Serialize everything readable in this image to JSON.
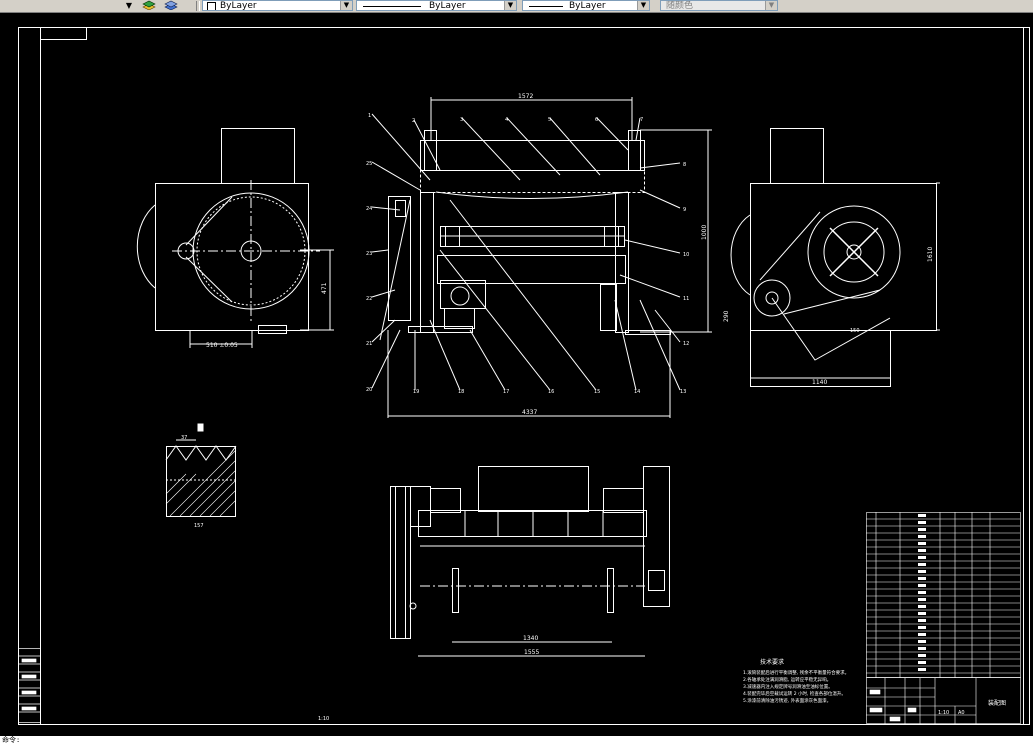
{
  "toolbar": {
    "layer_dropdown_arrow": "▼",
    "color_combo": "ByLayer",
    "linetype_combo": "ByLayer",
    "lineweight_combo": "ByLayer",
    "plotstyle_combo": "随颜色",
    "dropdown_arrow": "▼"
  },
  "drawing": {
    "front_view_width_dim": "1572",
    "front_view_total_dim": "4337",
    "front_view_height_dim": "1000",
    "side_left_dim": "510 ±0.05",
    "side_left_height_dim": "471",
    "side_right_width_dim": "1140",
    "side_right_height_dim": "1610",
    "side_right_bottom_dim": "290",
    "side_right_radius_label": "150",
    "detail_top_dim": "37",
    "detail_bottom_dim": "157",
    "plan_inner_dim": "1340",
    "plan_outer_dim": "1555",
    "scale_label": "1:10",
    "part_numbers_top": [
      "1",
      "2",
      "3",
      "4",
      "5",
      "6",
      "7",
      "8",
      "9",
      "10",
      "11",
      "12",
      "13",
      "14",
      "15",
      "16",
      "17",
      "18",
      "19",
      "20",
      "21",
      "22",
      "23",
      "24",
      "25"
    ],
    "tech_req_title": "技术要求",
    "tech_req_lines": [
      "1.滚筒装配后进行平衡调整, 残余不平衡量符合要求。",
      "2.各轴承处注满润滑脂, 运转应平稳无异响。",
      "3.减速器内注入规定牌号润滑油至油标位置。",
      "4.装配完毕后空载试运转 2 小时, 检查各部位温升。",
      "5.涂漆前清除油污锈迹, 外表面涂灰色面漆。"
    ],
    "title_block_name": "装配图",
    "title_block_scale": "1:10",
    "title_block_sheet": "A0"
  },
  "cmdline": {
    "prompt": "命令:"
  }
}
